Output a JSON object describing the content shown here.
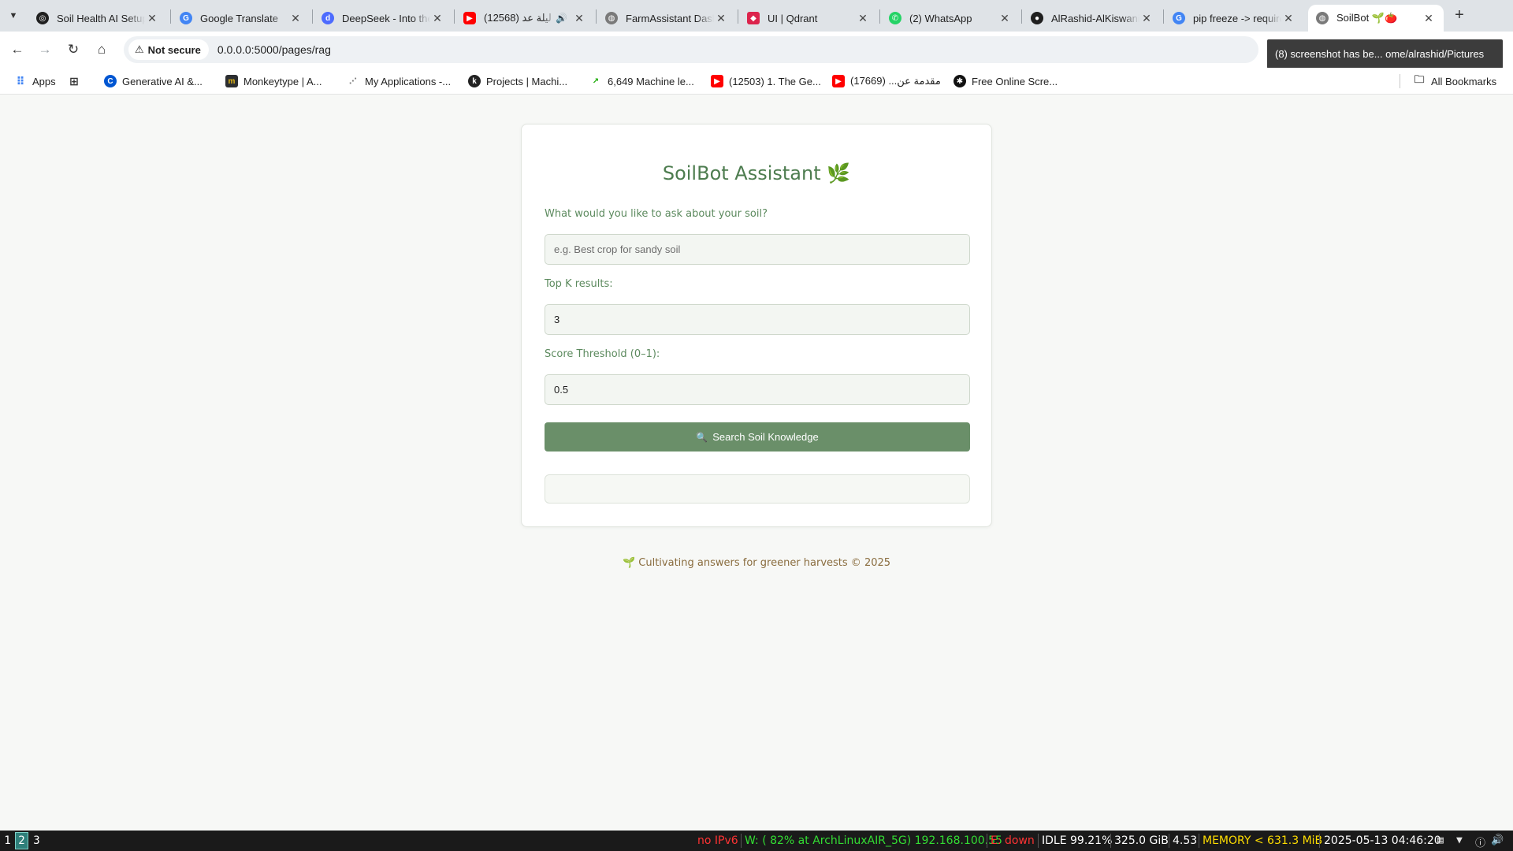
{
  "browser": {
    "tabs": [
      {
        "title": "Soil Health AI Setup",
        "favicon": "openai-icon",
        "color": "#202020",
        "glyph": "◎"
      },
      {
        "title": "Google Translate",
        "favicon": "translate-icon",
        "color": "#4285f4",
        "glyph": "G"
      },
      {
        "title": "DeepSeek - Into the Unknown",
        "favicon": "deepseek-icon",
        "color": "#4d6bfe",
        "glyph": "d"
      },
      {
        "title": "ليلة عد (12568)",
        "favicon": "youtube-icon",
        "color": "#ff0000",
        "glyph": "▶"
      },
      {
        "title": "FarmAssistant Dashboard",
        "favicon": "globe-icon",
        "color": "#7a7a7a",
        "glyph": "◍"
      },
      {
        "title": "UI | Qdrant",
        "favicon": "qdrant-icon",
        "color": "#dc244c",
        "glyph": "◆"
      },
      {
        "title": "(2) WhatsApp",
        "favicon": "whatsapp-icon",
        "color": "#25d366",
        "glyph": "✆"
      },
      {
        "title": "AlRashid-AlKiswani",
        "favicon": "github-icon",
        "color": "#1f1f1f",
        "glyph": "●"
      },
      {
        "title": "pip freeze -> requirements",
        "favicon": "google-icon",
        "color": "#4285f4",
        "glyph": "G"
      },
      {
        "title": "SoilBot 🌱🍅",
        "favicon": "globe-icon",
        "color": "#7a7a7a",
        "glyph": "◍"
      }
    ],
    "active_tab_index": 9,
    "security_label": "Not secure",
    "url": "0.0.0.0:5000/pages/rag",
    "tooltip": "(8) screenshot has be...   ome/alrashid/Pictures",
    "bookmarks": [
      {
        "label": "Apps",
        "icon": "apps-grid-icon"
      },
      {
        "label": "",
        "icon": "tab-groups-icon"
      },
      {
        "label": "Generative AI &...",
        "icon": "coursera-icon"
      },
      {
        "label": "Monkeytype | A...",
        "icon": "monkeytype-icon"
      },
      {
        "label": "My Applications -...",
        "icon": "link-icon"
      },
      {
        "label": "Projects | Machi...",
        "icon": "kaggle-icon"
      },
      {
        "label": "6,649 Machine le...",
        "icon": "upwork-icon"
      },
      {
        "label": "(12503) 1. The Ge...",
        "icon": "youtube-icon"
      },
      {
        "label": "مقدمة عن... (17669)",
        "icon": "youtube-icon"
      },
      {
        "label": "Free Online Scre...",
        "icon": "screen-recorder-icon"
      }
    ],
    "all_bookmarks_label": "All Bookmarks"
  },
  "app": {
    "title": "SoilBot Assistant 🌿",
    "question_label": "What would you like to ask about your soil?",
    "question_placeholder": "e.g. Best crop for sandy soil",
    "question_value": "",
    "topk_label": "Top K results:",
    "topk_value": "3",
    "threshold_label": "Score Threshold (0–1):",
    "threshold_value": "0.5",
    "search_button": "Search Soil Knowledge",
    "results_text": "",
    "footer": "🌱 Cultivating answers for greener harvests © 2025",
    "colors": {
      "accent": "#6a8f69",
      "title": "#4d7c4f",
      "label": "#5c8a5e",
      "footer": "#8a6d3f"
    }
  },
  "statusbar": {
    "workspaces": [
      "1",
      "2",
      "3"
    ],
    "active_workspace": "2",
    "ipv6": "no IPv6",
    "wifi": "W: ( 82% at ArchLinuxAIR_5G) 192.168.100.55",
    "ethernet": "E: down",
    "cpu": "IDLE 99.21%",
    "disk": "325.0 GiB",
    "load": "4.53",
    "memory": "MEMORY < 631.3 MiB",
    "datetime": "2025-05-13 04:46:20",
    "colors": {
      "ipv6": "#ff3333",
      "wifi": "#33dd33",
      "ethernet": "#ff3333",
      "neutral": "#ffffff",
      "memory": "#ffdd00"
    }
  }
}
